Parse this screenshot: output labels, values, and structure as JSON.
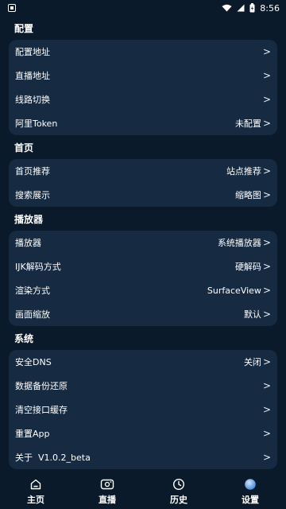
{
  "status": {
    "time": "8:56"
  },
  "sections": [
    {
      "title": "配置",
      "rows": [
        {
          "label": "配置地址",
          "value": ""
        },
        {
          "label": "直播地址",
          "value": ""
        },
        {
          "label": "线路切换",
          "value": ""
        },
        {
          "label": "阿里Token",
          "value": "未配置"
        }
      ]
    },
    {
      "title": "首页",
      "rows": [
        {
          "label": "首页推荐",
          "value": "站点推荐"
        },
        {
          "label": "搜索展示",
          "value": "缩略图"
        }
      ]
    },
    {
      "title": "播放器",
      "rows": [
        {
          "label": "播放器",
          "value": "系统播放器"
        },
        {
          "label": "IJK解码方式",
          "value": "硬解码"
        },
        {
          "label": "渲染方式",
          "value": "SurfaceView"
        },
        {
          "label": "画面缩放",
          "value": "默认"
        }
      ]
    },
    {
      "title": "系统",
      "rows": [
        {
          "label": "安全DNS",
          "value": "关闭"
        },
        {
          "label": "数据备份还原",
          "value": ""
        },
        {
          "label": "清空接口缓存",
          "value": ""
        },
        {
          "label": "重置App",
          "value": ""
        },
        {
          "label": "关于  V1.0.2_beta",
          "value": ""
        }
      ]
    }
  ],
  "chevron": ">",
  "nav": [
    {
      "label": "主页",
      "icon": "home-icon"
    },
    {
      "label": "直播",
      "icon": "live-tv-icon"
    },
    {
      "label": "历史",
      "icon": "history-clock-icon"
    },
    {
      "label": "设置",
      "icon": "settings-icon"
    }
  ],
  "colors": {
    "background": "#0b1a2a",
    "card": "#162b42",
    "accent": "#5aa0e8"
  }
}
